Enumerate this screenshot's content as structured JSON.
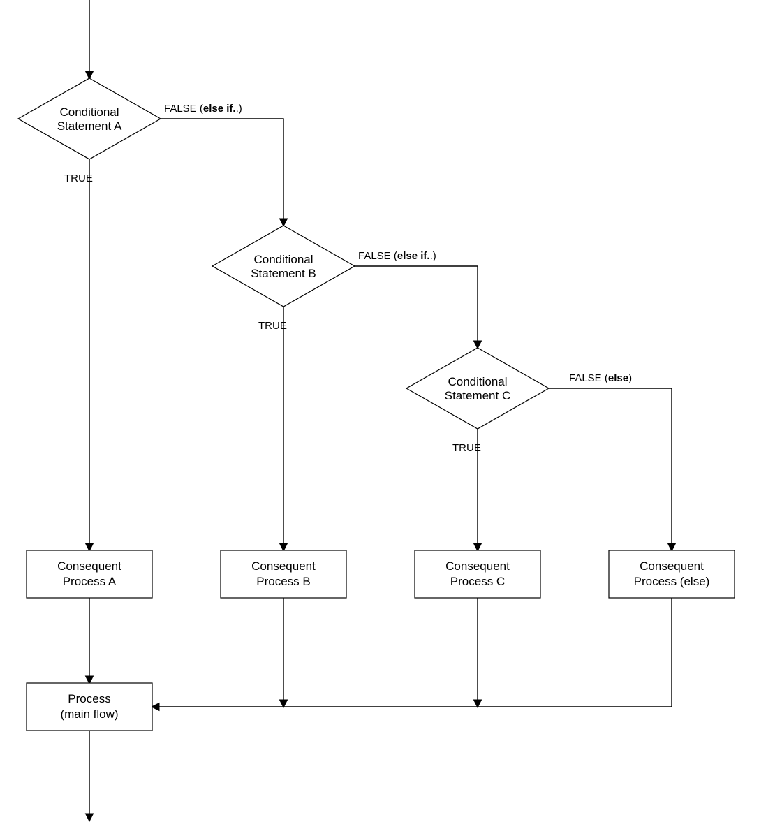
{
  "nodes": {
    "condA": {
      "line1": "Conditional",
      "line2": "Statement A"
    },
    "condB": {
      "line1": "Conditional",
      "line2": "Statement B"
    },
    "condC": {
      "line1": "Conditional",
      "line2": "Statement C"
    },
    "procA": {
      "line1": "Consequent",
      "line2": "Process A"
    },
    "procB": {
      "line1": "Consequent",
      "line2": "Process B"
    },
    "procC": {
      "line1": "Consequent",
      "line2": "Process C"
    },
    "procElse": {
      "line1": "Consequent",
      "line2": "Process (else)"
    },
    "main": {
      "line1": "Process",
      "line2": "(main flow)"
    }
  },
  "labels": {
    "true": "TRUE",
    "falseElseIfPrefix": "FALSE (",
    "falseElseIfBold": "else if.",
    "falseElseIfSuffix": ".)",
    "falseElsePrefix": "FALSE (",
    "falseElseBold": "else",
    "falseElseSuffix": ")"
  }
}
